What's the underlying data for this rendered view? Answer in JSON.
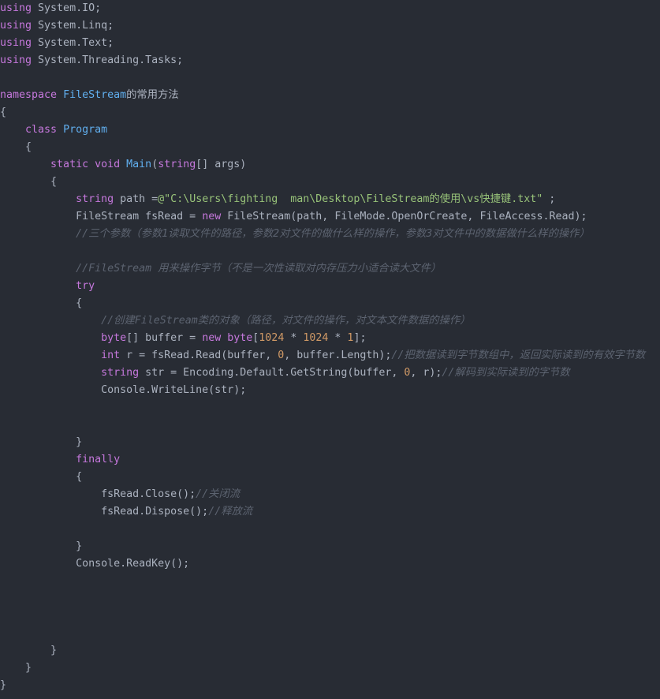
{
  "editor": {
    "lines": [
      [
        {
          "t": "using",
          "c": "kw"
        },
        {
          "t": " System.IO;",
          "c": "pl"
        }
      ],
      [
        {
          "t": "using",
          "c": "kw"
        },
        {
          "t": " System.Linq;",
          "c": "pl"
        }
      ],
      [
        {
          "t": "using",
          "c": "kw"
        },
        {
          "t": " System.Text;",
          "c": "pl"
        }
      ],
      [
        {
          "t": "using",
          "c": "kw"
        },
        {
          "t": " System.Threading.Tasks;",
          "c": "pl"
        }
      ],
      [],
      [
        {
          "t": "namespace",
          "c": "kw"
        },
        {
          "t": " ",
          "c": "pl"
        },
        {
          "t": "FileStream",
          "c": "ty"
        },
        {
          "t": "的常用方法",
          "c": "pl"
        }
      ],
      [
        {
          "t": "{",
          "c": "pl"
        }
      ],
      [
        {
          "t": "    ",
          "c": "pl"
        },
        {
          "t": "class",
          "c": "kw"
        },
        {
          "t": " ",
          "c": "pl"
        },
        {
          "t": "Program",
          "c": "ty"
        }
      ],
      [
        {
          "t": "    {",
          "c": "pl"
        }
      ],
      [
        {
          "t": "        ",
          "c": "pl"
        },
        {
          "t": "static",
          "c": "kw"
        },
        {
          "t": " ",
          "c": "pl"
        },
        {
          "t": "void",
          "c": "kw"
        },
        {
          "t": " ",
          "c": "pl"
        },
        {
          "t": "Main",
          "c": "ty"
        },
        {
          "t": "(",
          "c": "pl"
        },
        {
          "t": "string",
          "c": "kw"
        },
        {
          "t": "[] args)",
          "c": "pl"
        }
      ],
      [
        {
          "t": "        {",
          "c": "pl"
        }
      ],
      [
        {
          "t": "            ",
          "c": "pl"
        },
        {
          "t": "string",
          "c": "kw"
        },
        {
          "t": " path =",
          "c": "pl"
        },
        {
          "t": "@\"C:\\Users\\fighting  man\\Desktop\\FileStream的使用\\vs快捷键.txt\"",
          "c": "str"
        },
        {
          "t": " ;",
          "c": "pl"
        }
      ],
      [
        {
          "t": "            FileStream fsRead = ",
          "c": "pl"
        },
        {
          "t": "new",
          "c": "kw"
        },
        {
          "t": " FileStream(path, FileMode.OpenOrCreate, FileAccess.Read);",
          "c": "pl"
        }
      ],
      [
        {
          "t": "            ",
          "c": "pl"
        },
        {
          "t": "//三个参数（参数1读取文件的路径，参数2对文件的做什么样的操作，参数3对文件中的数据做什么样的操作）",
          "c": "cm"
        }
      ],
      [],
      [
        {
          "t": "            ",
          "c": "pl"
        },
        {
          "t": "//FileStream 用来操作字节（不是一次性读取对内存压力小适合读大文件）",
          "c": "cm"
        }
      ],
      [
        {
          "t": "            ",
          "c": "pl"
        },
        {
          "t": "try",
          "c": "kw"
        }
      ],
      [
        {
          "t": "            {",
          "c": "pl"
        }
      ],
      [
        {
          "t": "                ",
          "c": "pl"
        },
        {
          "t": "//创建FileStream类的对象（路径，对文件的操作，对文本文件数据的操作）",
          "c": "cm"
        }
      ],
      [
        {
          "t": "                ",
          "c": "pl"
        },
        {
          "t": "byte",
          "c": "kw"
        },
        {
          "t": "[] buffer = ",
          "c": "pl"
        },
        {
          "t": "new",
          "c": "kw"
        },
        {
          "t": " ",
          "c": "pl"
        },
        {
          "t": "byte",
          "c": "kw"
        },
        {
          "t": "[",
          "c": "pl"
        },
        {
          "t": "1024",
          "c": "num"
        },
        {
          "t": " * ",
          "c": "pl"
        },
        {
          "t": "1024",
          "c": "num"
        },
        {
          "t": " * ",
          "c": "pl"
        },
        {
          "t": "1",
          "c": "num"
        },
        {
          "t": "];",
          "c": "pl"
        }
      ],
      [
        {
          "t": "                ",
          "c": "pl"
        },
        {
          "t": "int",
          "c": "kw"
        },
        {
          "t": " r = fsRead.Read(buffer, ",
          "c": "pl"
        },
        {
          "t": "0",
          "c": "num"
        },
        {
          "t": ", buffer.Length);",
          "c": "pl"
        },
        {
          "t": "//把数据读到字节数组中，返回实际读到的有效字节数",
          "c": "cm"
        }
      ],
      [
        {
          "t": "                ",
          "c": "pl"
        },
        {
          "t": "string",
          "c": "kw"
        },
        {
          "t": " str = Encoding.Default.GetString(buffer, ",
          "c": "pl"
        },
        {
          "t": "0",
          "c": "num"
        },
        {
          "t": ", r);",
          "c": "pl"
        },
        {
          "t": "//解码到实际读到的字节数",
          "c": "cm"
        }
      ],
      [
        {
          "t": "                Console.WriteLine(str);",
          "c": "pl"
        }
      ],
      [],
      [],
      [
        {
          "t": "            }",
          "c": "pl"
        }
      ],
      [
        {
          "t": "            ",
          "c": "pl"
        },
        {
          "t": "finally",
          "c": "kw"
        }
      ],
      [
        {
          "t": "            {",
          "c": "pl"
        }
      ],
      [
        {
          "t": "                fsRead.Close();",
          "c": "pl"
        },
        {
          "t": "//关闭流",
          "c": "cm"
        }
      ],
      [
        {
          "t": "                fsRead.Dispose();",
          "c": "pl"
        },
        {
          "t": "//释放流",
          "c": "cm"
        }
      ],
      [],
      [
        {
          "t": "            }",
          "c": "pl"
        }
      ],
      [
        {
          "t": "            Console.ReadKey();",
          "c": "pl"
        }
      ],
      [],
      [],
      [],
      [],
      [
        {
          "t": "        }",
          "c": "pl"
        }
      ],
      [
        {
          "t": "    }",
          "c": "pl"
        }
      ],
      [
        {
          "t": "}",
          "c": "pl"
        }
      ]
    ]
  }
}
